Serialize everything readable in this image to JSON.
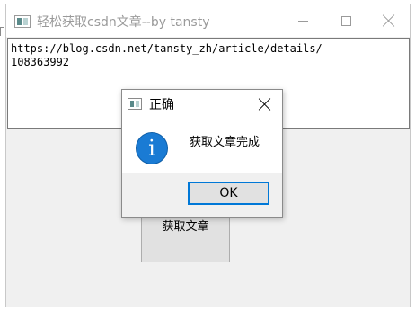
{
  "window": {
    "title": "轻松获取csdn文章--by tansty"
  },
  "main": {
    "url_text": "https://blog.csdn.net/tansty_zh/article/details/\n108363992",
    "fetch_button_label": "获取文章"
  },
  "dialog": {
    "title": "正确",
    "icon_glyph": "i",
    "message": "获取文章完成",
    "ok_label": "OK"
  },
  "colors": {
    "accent": "#0078d7",
    "info_icon": "#1a7bd4",
    "window_bg": "#f0f0f0"
  },
  "icons": {
    "app": "app-window-icon",
    "info": "info-icon"
  }
}
